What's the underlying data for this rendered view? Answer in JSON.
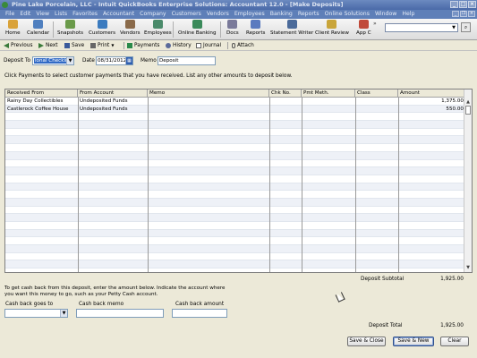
{
  "window": {
    "title": "Pine Lake Porcelain, LLC  -  Intuit QuickBooks Enterprise Solutions: Accountant 12.0 - [Make Deposits]"
  },
  "menu": [
    "File",
    "Edit",
    "View",
    "Lists",
    "Favorites",
    "Accountant",
    "Company",
    "Customers",
    "Vendors",
    "Employees",
    "Banking",
    "Reports",
    "Online Solutions",
    "Window",
    "Help"
  ],
  "iconbar": [
    {
      "label": "Home",
      "icon": "home-icon",
      "color": "#d9a23a"
    },
    {
      "label": "Calendar",
      "icon": "calendar-icon",
      "color": "#4f7fbf"
    },
    {
      "label": "Snapshots",
      "icon": "snapshots-icon",
      "color": "#6a9a4a"
    },
    {
      "label": "Customers",
      "icon": "customers-icon",
      "color": "#3b7bbf"
    },
    {
      "label": "Vendors",
      "icon": "vendors-icon",
      "color": "#8a6a4a"
    },
    {
      "label": "Employees",
      "icon": "employees-icon",
      "color": "#4a8a6a"
    },
    {
      "label": "Online Banking",
      "icon": "online-banking-icon",
      "color": "#3a8a5a"
    },
    {
      "label": "Docs",
      "icon": "docs-icon",
      "color": "#7a7a9a"
    },
    {
      "label": "Reports",
      "icon": "reports-icon",
      "color": "#5a7abf"
    },
    {
      "label": "Statement Writer",
      "icon": "statement-writer-icon",
      "color": "#4a6a9a"
    },
    {
      "label": "Client Review",
      "icon": "client-review-icon",
      "color": "#c9a53a"
    },
    {
      "label": "App C",
      "icon": "app-center-icon",
      "color": "#c04a3a"
    }
  ],
  "iconbar_more": "»",
  "toolbar": {
    "previous": "Previous",
    "next": "Next",
    "save": "Save",
    "print": "Print",
    "payments": "Payments",
    "history": "History",
    "journal": "Journal",
    "attach": "Attach"
  },
  "form": {
    "deposit_to_label": "Deposit To",
    "deposit_to_value": "ional Checkin",
    "date_label": "Date",
    "date_value": "08/31/2012",
    "memo_label": "Memo",
    "memo_value": "Deposit"
  },
  "instructions": "Click Payments to select customer payments that you have received. List any other amounts to deposit below.",
  "grid": {
    "columns": [
      "Received From",
      "From Account",
      "Memo",
      "Chk No.",
      "Pmt Meth.",
      "Class",
      "Amount"
    ],
    "rows": [
      [
        "Rainy Day Collectibles",
        "Undeposited Funds",
        "",
        "",
        "",
        "",
        "1,375.00"
      ],
      [
        "Castlerock Coffee House",
        "Undeposited Funds",
        "",
        "",
        "",
        "",
        "550.00"
      ]
    ],
    "empty_rows": 20
  },
  "subtotal": {
    "label": "Deposit Subtotal",
    "value": "1,925.00"
  },
  "cashback": {
    "instructions": "To get cash back from this deposit, enter the amount below.  Indicate the account where you want this money to go, such as your Petty Cash account.",
    "goes_to_label": "Cash back goes to",
    "memo_label": "Cash back memo",
    "amount_label": "Cash back amount"
  },
  "total": {
    "label": "Deposit Total",
    "value": "1,925.00"
  },
  "buttons": {
    "save_close": "Save & Close",
    "save_new": "Save & New",
    "clear": "Clear"
  }
}
